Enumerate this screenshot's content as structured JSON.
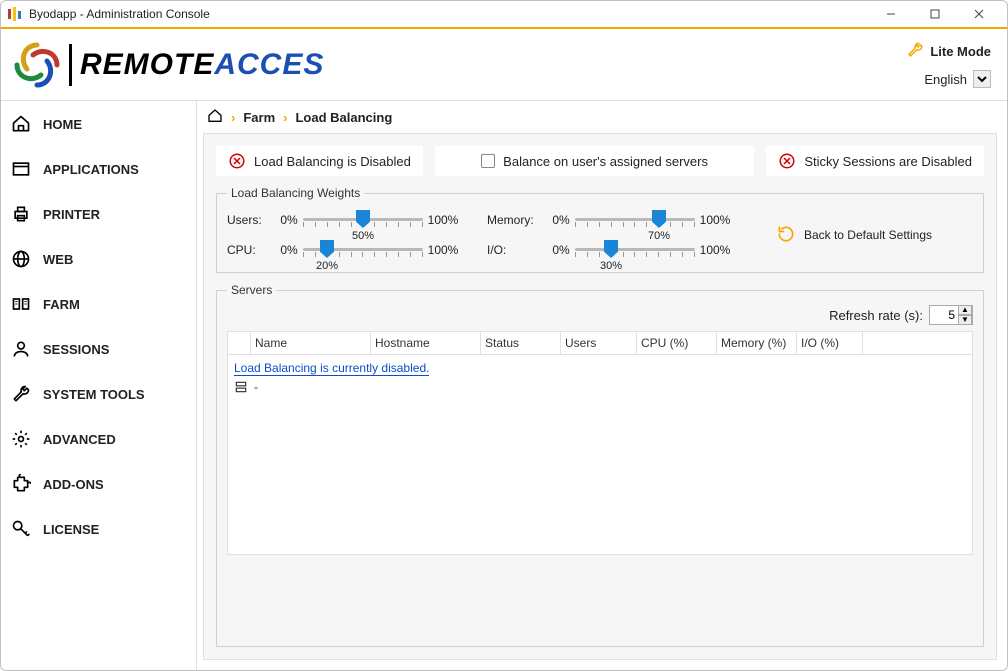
{
  "window": {
    "title": "Byodapp - Administration Console"
  },
  "header": {
    "logo_remote": "REMOTE",
    "logo_access": " ACCES",
    "lite_mode": "Lite Mode",
    "language": "English"
  },
  "sidebar": {
    "items": [
      {
        "label": "HOME"
      },
      {
        "label": "APPLICATIONS"
      },
      {
        "label": "PRINTER"
      },
      {
        "label": "WEB"
      },
      {
        "label": "FARM"
      },
      {
        "label": "SESSIONS"
      },
      {
        "label": "SYSTEM TOOLS"
      },
      {
        "label": "ADVANCED"
      },
      {
        "label": "ADD-ONS"
      },
      {
        "label": "LICENSE"
      }
    ]
  },
  "breadcrumb": {
    "a": "Farm",
    "b": "Load Balancing"
  },
  "status": {
    "lb_disabled": "Load Balancing is Disabled",
    "balance_on_assigned": "Balance on user's assigned servers",
    "sticky_disabled": "Sticky Sessions are Disabled"
  },
  "weights": {
    "legend": "Load Balancing Weights",
    "min": "0%",
    "max": "100%",
    "users": {
      "label": "Users:",
      "value": "50%",
      "pos": 50
    },
    "cpu": {
      "label": "CPU:",
      "value": "20%",
      "pos": 20
    },
    "memory": {
      "label": "Memory:",
      "value": "70%",
      "pos": 70
    },
    "io": {
      "label": "I/O:",
      "value": "30%",
      "pos": 30
    },
    "back_default": "Back to Default Settings"
  },
  "servers": {
    "legend": "Servers",
    "refresh_label": "Refresh rate (s):",
    "refresh_value": "5",
    "cols": {
      "name": "Name",
      "hostname": "Hostname",
      "status": "Status",
      "users": "Users",
      "cpu": "CPU (%)",
      "memory": "Memory (%)",
      "io": "I/O (%)"
    },
    "msg": "Load Balancing is currently disabled.",
    "empty_row": "-"
  }
}
